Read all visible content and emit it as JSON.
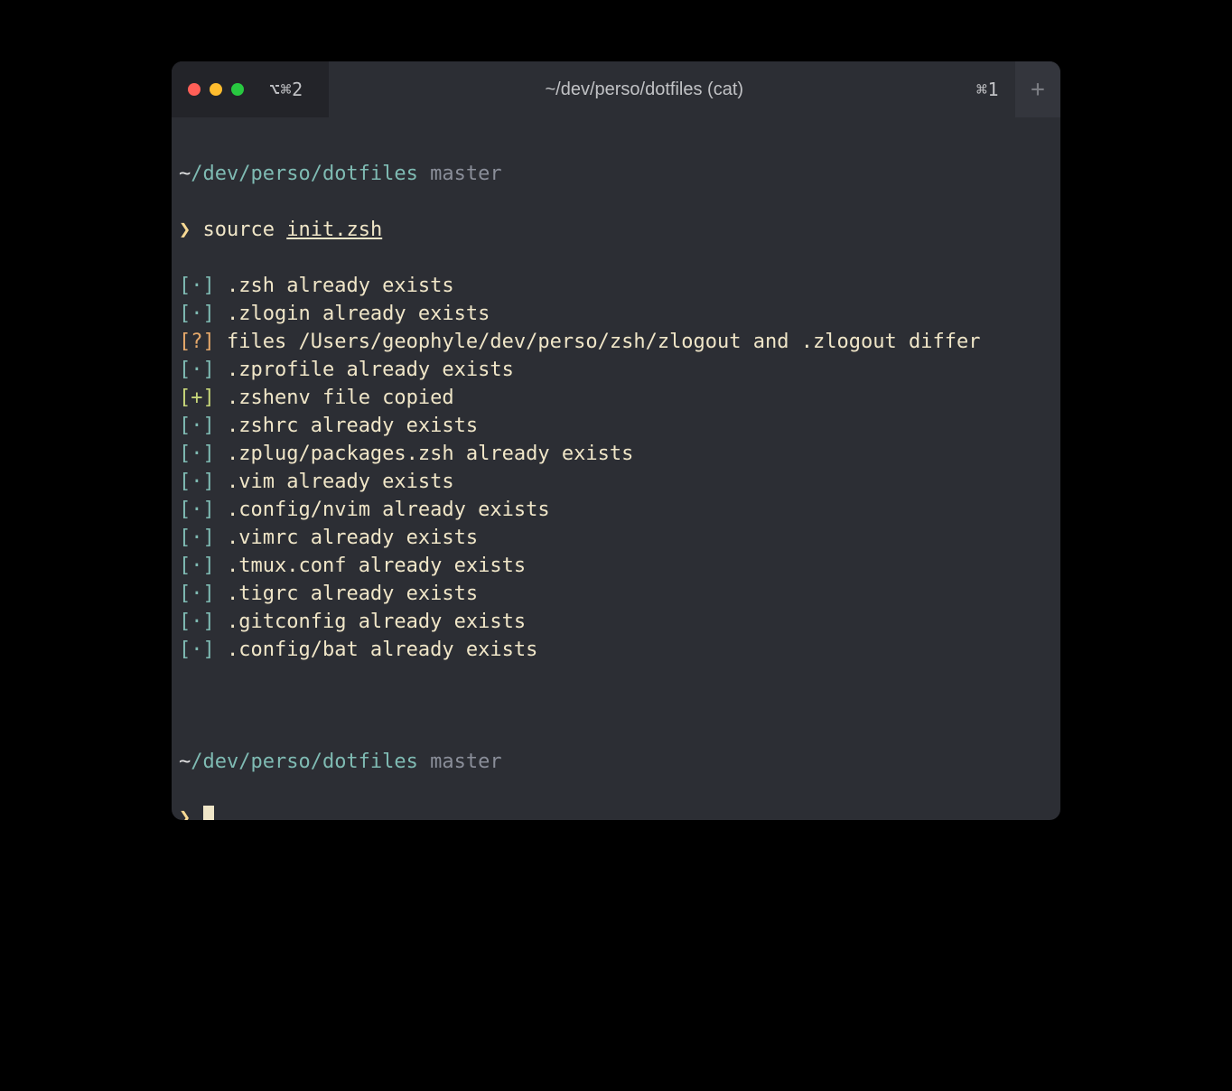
{
  "titlebar": {
    "left_tab_label": "⌥⌘2",
    "title": "~/dev/perso/dotfiles (cat)",
    "right_tab_label": "⌘1",
    "new_tab_glyph": "+"
  },
  "prompt1": {
    "path_prefix": "~",
    "path_rest": "/dev/perso/dotfiles",
    "branch": "master",
    "caret": "❯",
    "command": "source",
    "argument": "init.zsh"
  },
  "lines": [
    {
      "status": "neutral",
      "badge": "[·]",
      "text": ".zsh already exists"
    },
    {
      "status": "neutral",
      "badge": "[·]",
      "text": ".zlogin already exists"
    },
    {
      "status": "warn",
      "badge": "[?]",
      "text": "files /Users/geophyle/dev/perso/zsh/zlogout and .zlogout differ"
    },
    {
      "status": "neutral",
      "badge": "[·]",
      "text": ".zprofile already exists"
    },
    {
      "status": "ok",
      "badge": "[+]",
      "text": ".zshenv file copied"
    },
    {
      "status": "neutral",
      "badge": "[·]",
      "text": ".zshrc already exists"
    },
    {
      "status": "neutral",
      "badge": "[·]",
      "text": ".zplug/packages.zsh already exists"
    },
    {
      "status": "neutral",
      "badge": "[·]",
      "text": ".vim already exists"
    },
    {
      "status": "neutral",
      "badge": "[·]",
      "text": ".config/nvim already exists"
    },
    {
      "status": "neutral",
      "badge": "[·]",
      "text": ".vimrc already exists"
    },
    {
      "status": "neutral",
      "badge": "[·]",
      "text": ".tmux.conf already exists"
    },
    {
      "status": "neutral",
      "badge": "[·]",
      "text": ".tigrc already exists"
    },
    {
      "status": "neutral",
      "badge": "[·]",
      "text": ".gitconfig already exists"
    },
    {
      "status": "neutral",
      "badge": "[·]",
      "text": ".config/bat already exists"
    }
  ],
  "prompt2": {
    "path_prefix": "~",
    "path_rest": "/dev/perso/dotfiles",
    "branch": "master",
    "caret": "❯"
  }
}
